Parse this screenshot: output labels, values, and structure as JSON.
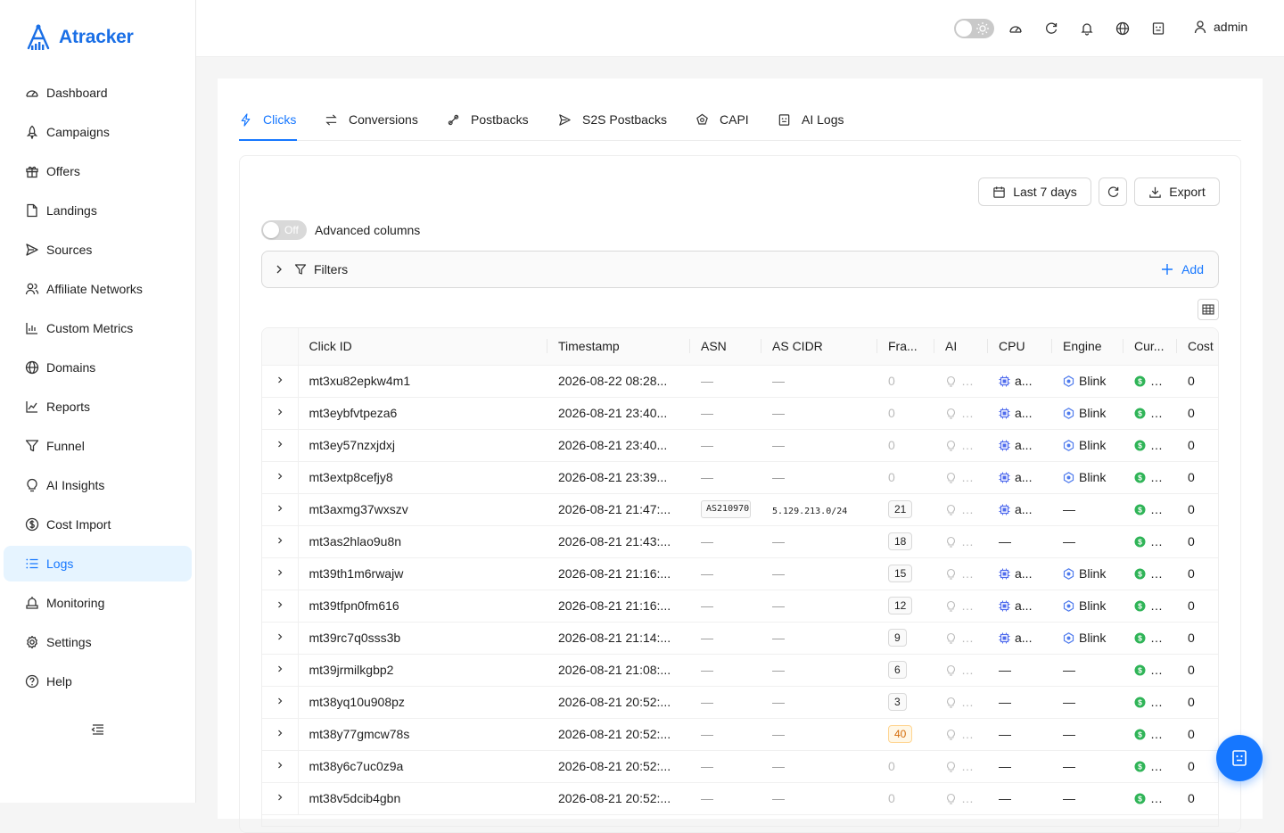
{
  "app": {
    "name": "Atracker",
    "brand_color": "#1a6fe6",
    "accent": "#1677ff"
  },
  "sidebar": {
    "items": [
      {
        "label": "Dashboard",
        "icon": "dashboard-icon"
      },
      {
        "label": "Campaigns",
        "icon": "rocket-icon"
      },
      {
        "label": "Offers",
        "icon": "gift-icon"
      },
      {
        "label": "Landings",
        "icon": "file-icon"
      },
      {
        "label": "Sources",
        "icon": "send-icon"
      },
      {
        "label": "Affiliate Networks",
        "icon": "team-icon"
      },
      {
        "label": "Custom Metrics",
        "icon": "bar-chart-icon"
      },
      {
        "label": "Domains",
        "icon": "globe-icon"
      },
      {
        "label": "Reports",
        "icon": "line-chart-icon"
      },
      {
        "label": "Funnel",
        "icon": "funnel-icon"
      },
      {
        "label": "AI Insights",
        "icon": "bulb-icon"
      },
      {
        "label": "Cost Import",
        "icon": "dollar-icon"
      },
      {
        "label": "Logs",
        "icon": "list-icon",
        "active": true
      },
      {
        "label": "Monitoring",
        "icon": "monitor-icon"
      },
      {
        "label": "Settings",
        "icon": "gear-icon"
      },
      {
        "label": "Help",
        "icon": "question-icon"
      }
    ]
  },
  "topbar": {
    "user": "admin"
  },
  "tabs": [
    {
      "label": "Clicks",
      "active": true
    },
    {
      "label": "Conversions"
    },
    {
      "label": "Postbacks"
    },
    {
      "label": "S2S Postbacks"
    },
    {
      "label": "CAPI"
    },
    {
      "label": "AI Logs"
    }
  ],
  "toolbar": {
    "date_range": "Last 7 days",
    "export": "Export"
  },
  "advanced": {
    "switch_text": "Off",
    "label": "Advanced columns"
  },
  "filters": {
    "label": "Filters",
    "add": "Add"
  },
  "table": {
    "columns": [
      "Click ID",
      "Timestamp",
      "ASN",
      "AS CIDR",
      "Fra...",
      "AI",
      "CPU",
      "Engine",
      "Cur...",
      "Cost"
    ],
    "rows": [
      {
        "id": "mt3xu82epkw4m1",
        "ts": "2026-08-22 08:28...",
        "asn": "—",
        "cidr": "—",
        "fraud": "0",
        "cpu": "a...",
        "engine": "Blink",
        "cost": "0"
      },
      {
        "id": "mt3eybfvtpeza6",
        "ts": "2026-08-21 23:40...",
        "asn": "—",
        "cidr": "—",
        "fraud": "0",
        "cpu": "a...",
        "engine": "Blink",
        "cost": "0"
      },
      {
        "id": "mt3ey57nzxjdxj",
        "ts": "2026-08-21 23:40...",
        "asn": "—",
        "cidr": "—",
        "fraud": "0",
        "cpu": "a...",
        "engine": "Blink",
        "cost": "0"
      },
      {
        "id": "mt3extp8cefjy8",
        "ts": "2026-08-21 23:39...",
        "asn": "—",
        "cidr": "—",
        "fraud": "0",
        "cpu": "a...",
        "engine": "Blink",
        "cost": "0"
      },
      {
        "id": "mt3axmg37wxszv",
        "ts": "2026-08-21 21:47:...",
        "asn": "AS210970",
        "cidr": "5.129.213.0/24",
        "fraud": "21",
        "cpu": "a...",
        "engine": "—",
        "cost": "0"
      },
      {
        "id": "mt3as2hlao9u8n",
        "ts": "2026-08-21 21:43:...",
        "asn": "—",
        "cidr": "—",
        "fraud": "18",
        "cpu": "—",
        "engine": "—",
        "cost": "0"
      },
      {
        "id": "mt39th1m6rwajw",
        "ts": "2026-08-21 21:16:...",
        "asn": "—",
        "cidr": "—",
        "fraud": "15",
        "cpu": "a...",
        "engine": "Blink",
        "cost": "0"
      },
      {
        "id": "mt39tfpn0fm616",
        "ts": "2026-08-21 21:16:...",
        "asn": "—",
        "cidr": "—",
        "fraud": "12",
        "cpu": "a...",
        "engine": "Blink",
        "cost": "0"
      },
      {
        "id": "mt39rc7q0sss3b",
        "ts": "2026-08-21 21:14:...",
        "asn": "—",
        "cidr": "—",
        "fraud": "9",
        "cpu": "a...",
        "engine": "Blink",
        "cost": "0"
      },
      {
        "id": "mt39jrmilkgbp2",
        "ts": "2026-08-21 21:08:...",
        "asn": "—",
        "cidr": "—",
        "fraud": "6",
        "cpu": "—",
        "engine": "—",
        "cost": "0"
      },
      {
        "id": "mt38yq10u908pz",
        "ts": "2026-08-21 20:52:...",
        "asn": "—",
        "cidr": "—",
        "fraud": "3",
        "cpu": "—",
        "engine": "—",
        "cost": "0"
      },
      {
        "id": "mt38y77gmcw78s",
        "ts": "2026-08-21 20:52:...",
        "asn": "—",
        "cidr": "—",
        "fraud": "40",
        "fraud_warn": true,
        "cpu": "—",
        "engine": "—",
        "cost": "0"
      },
      {
        "id": "mt38y6c7uc0z9a",
        "ts": "2026-08-21 20:52:...",
        "asn": "—",
        "cidr": "—",
        "fraud": "0",
        "cpu": "—",
        "engine": "—",
        "cost": "0"
      },
      {
        "id": "mt38v5dcib4gbn",
        "ts": "2026-08-21 20:52:...",
        "asn": "—",
        "cidr": "—",
        "fraud": "0",
        "cpu": "—",
        "engine": "—",
        "cost": "0"
      }
    ]
  }
}
